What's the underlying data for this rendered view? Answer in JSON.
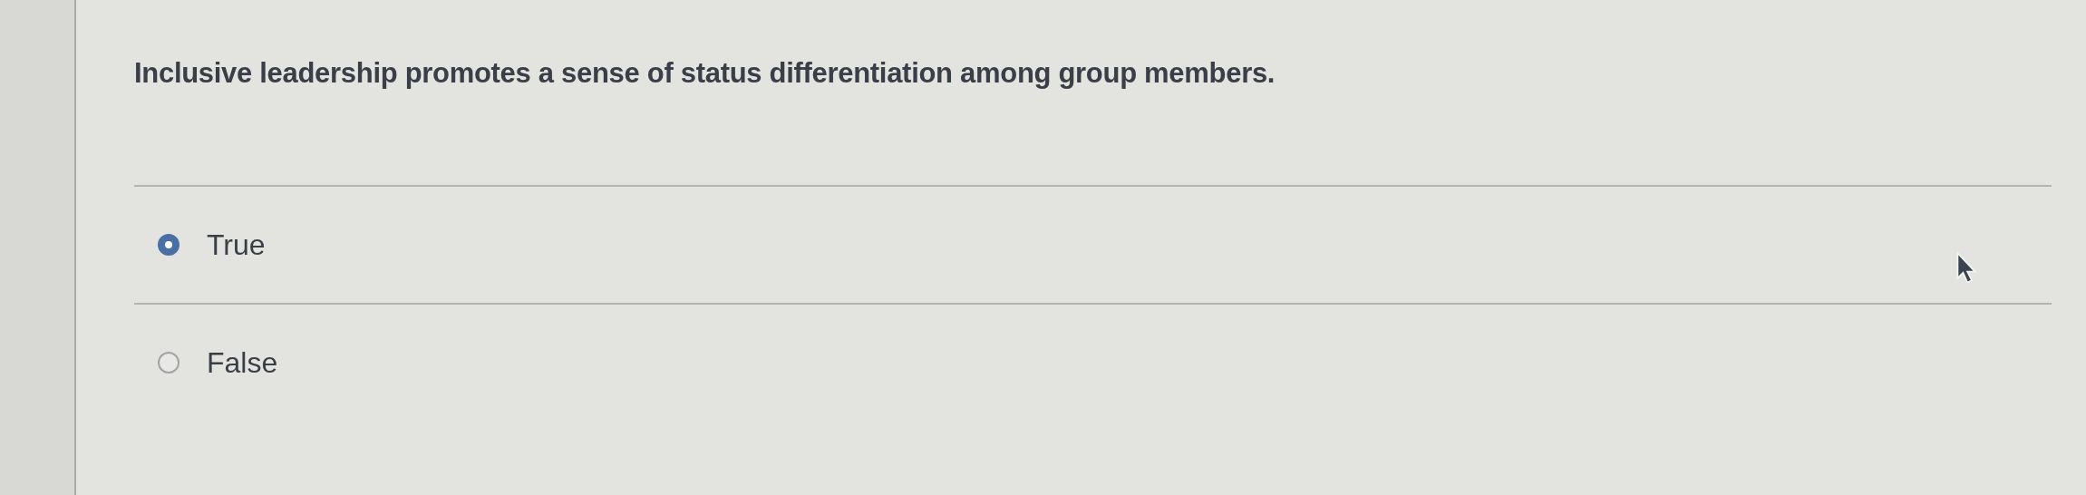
{
  "question": {
    "text": "Inclusive leadership promotes a sense of status differentiation among group members."
  },
  "options": [
    {
      "label": "True",
      "selected": true
    },
    {
      "label": "False",
      "selected": false
    }
  ]
}
